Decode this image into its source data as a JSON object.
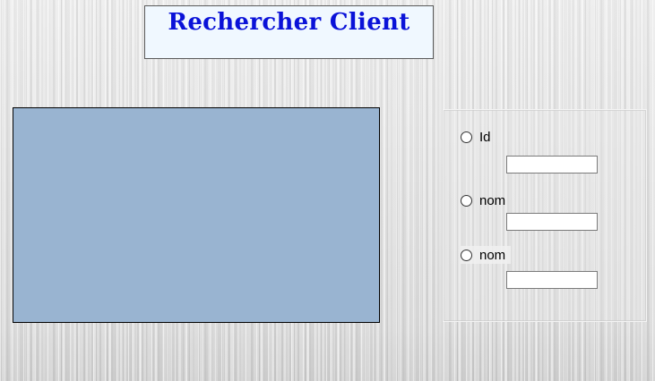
{
  "header": {
    "title": "Rechercher Client"
  },
  "search": {
    "options": [
      {
        "label": "Id",
        "value": ""
      },
      {
        "label": "nom",
        "value": ""
      },
      {
        "label": "nom",
        "value": ""
      }
    ]
  },
  "colors": {
    "title_text": "#0a12d8",
    "title_background": "#f0f8ff",
    "results_panel": "#99b4d1"
  }
}
